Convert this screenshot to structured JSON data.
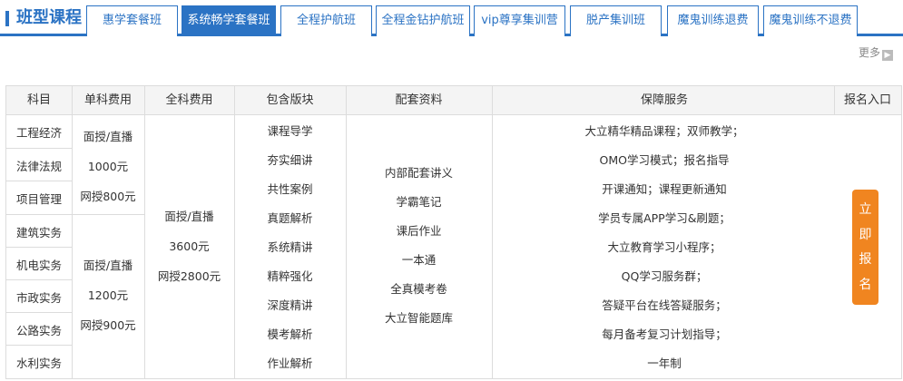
{
  "header": {
    "title": "班型课程",
    "tabs": [
      {
        "label": "惠学套餐班",
        "active": false
      },
      {
        "label": "系统畅学套餐班",
        "active": true
      },
      {
        "label": "全程护航班",
        "active": false
      },
      {
        "label": "全程金钻护航班",
        "active": false
      },
      {
        "label": "vip尊享集训营",
        "active": false
      },
      {
        "label": "脱产集训班",
        "active": false
      },
      {
        "label": "魔鬼训练退费",
        "active": false
      },
      {
        "label": "魔鬼训练不退费",
        "active": false
      }
    ],
    "more_label": "更多",
    "more_icon": "chevron-right-icon"
  },
  "table": {
    "columns": [
      "科目",
      "单科费用",
      "全科费用",
      "包含版块",
      "配套资料",
      "保障服务",
      "报名入口"
    ],
    "subjects_group1": [
      "工程经济",
      "法律法规",
      "项目管理"
    ],
    "subjects_group2": [
      "建筑实务",
      "机电实务",
      "市政实务",
      "公路实务",
      "水利实务"
    ],
    "single_fee_group1": [
      "面授/直播",
      "1000元",
      "网授800元"
    ],
    "single_fee_group2": [
      "面授/直播",
      "1200元",
      "网授900元"
    ],
    "all_fee": [
      "面授/直播",
      "3600元",
      "网授2800元"
    ],
    "modules": [
      "课程导学",
      "夯实细讲",
      "共性案例",
      "真题解析",
      "系统精讲",
      "精粹强化",
      "深度精讲",
      "模考解析",
      "作业解析"
    ],
    "materials": [
      "内部配套讲义",
      "学霸笔记",
      "课后作业",
      "一本通",
      "全真模考卷",
      "大立智能题库"
    ],
    "services": [
      "大立精华精品课程；双师教学；",
      "OMO学习模式；报名指导",
      "开课通知；课程更新通知",
      "学员专属APP学习&刷题；",
      "大立教育学习小程序；",
      "QQ学习服务群；",
      "答疑平台在线答疑服务；",
      "每月备考复习计划指导；",
      "一年制"
    ],
    "signup_chars": [
      "立",
      "即",
      "报",
      "名"
    ]
  },
  "colors": {
    "accent": "#2b73c4",
    "signup": "#f08520",
    "header_bg": "#f4f4f4",
    "border": "#dcdcdc"
  }
}
